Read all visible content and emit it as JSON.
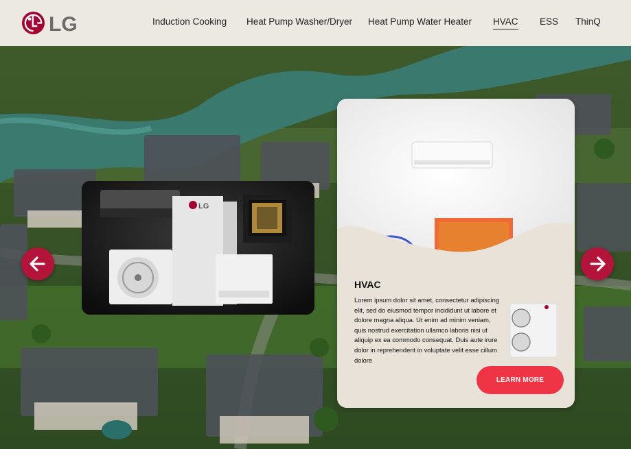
{
  "brand": {
    "name": "LG",
    "color": "#a50034"
  },
  "nav": {
    "items": [
      {
        "label": "Induction Cooking",
        "active": false
      },
      {
        "label": "Heat Pump Washer/Dryer",
        "active": false
      },
      {
        "label": "Heat Pump Water Heater",
        "active": false
      },
      {
        "label": "HVAC",
        "active": true
      },
      {
        "label": "ESS",
        "active": false
      },
      {
        "label": "ThinQ",
        "active": false
      }
    ]
  },
  "carousel": {
    "prev_icon": "arrow-left-icon",
    "next_icon": "arrow-right-icon",
    "arrow_color": "#b4133a"
  },
  "card": {
    "title": "HVAC",
    "body": "Lorem ipsum dolor sit amet, consectetur adipiscing elit, sed do eiusmod tempor incididunt ut labore et dolore magna aliqua. Ut enim ad minim veniam, quis nostrud exercitation ullamco laboris nisi ut aliquip ex ea commodo consequat. Duis aute irure dolor in reprehenderit in voluptate velit esse cillum dolore",
    "button_label": "LEARN MORE",
    "button_color": "#ee3445"
  },
  "product_image": {
    "brand_text": "LG"
  }
}
